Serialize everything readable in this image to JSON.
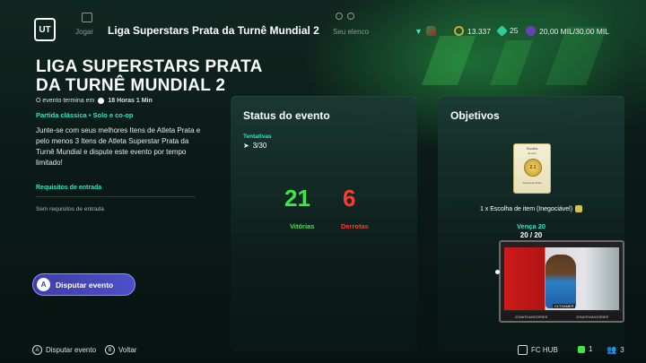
{
  "topbar": {
    "logo": "UT",
    "nav": [
      {
        "label": "Jogar",
        "icon": "play-icon"
      },
      {
        "label": "Seu elenco",
        "icon": "squad-icon"
      }
    ],
    "title": "Liga Superstars Prata da Turnê Mundial 2",
    "coins": "13.337",
    "points": "25",
    "stat3": "20,00 MIL/30,00 MIL"
  },
  "event": {
    "title_line1": "LIGA SUPERSTARS PRATA",
    "title_line2": "DA TURNÊ MUNDIAL 2",
    "timer_label": "O evento termina em",
    "timer_value": "18 Horas 1 Min",
    "mode": "Partida clássica • Solo e co-op",
    "description": "Junte-se com seus melhores Itens de Atleta Prata e pelo menos 3 Itens de Atleta Superstar Prata da Turnê Mundial e dispute este evento por tempo limitado!",
    "requirements_title": "Requisitos de entrada",
    "requirements_text": "Sem requisitos de entrada",
    "play_button": "Disputar evento",
    "play_glyph": "A"
  },
  "status": {
    "title": "Status do evento",
    "tries_label": "Tentativas",
    "tries_value": "3/30",
    "wins": "21",
    "wins_label": "Vitórias",
    "losses": "6",
    "losses_label": "Derrotas"
  },
  "objectives": {
    "title": "Objetivos",
    "card_title": "Escolha",
    "card_subtitle": "de item",
    "card_badge": "2.1",
    "card_footer": "Superstars Prata",
    "reward_text": "1 x Escolha de item (Inegociável)",
    "win_label": "Vença 20",
    "win_progress": "20 / 20"
  },
  "webcam": {
    "tag": "CLTXAMER",
    "bar_left": "JONATHANOORIEE",
    "bar_right": "JONATHANOORIEE"
  },
  "footer": {
    "hint1_glyph": "A",
    "hint1": "Disputar evento",
    "hint2_glyph": "B",
    "hint2": "Voltar",
    "hub": "FC HUB",
    "count1": "1",
    "count2": "3"
  },
  "colors": {
    "accent": "#2ee6c4",
    "wins": "#3ee64a",
    "losses": "#ff3a2a",
    "button": "#4d4fc7"
  }
}
